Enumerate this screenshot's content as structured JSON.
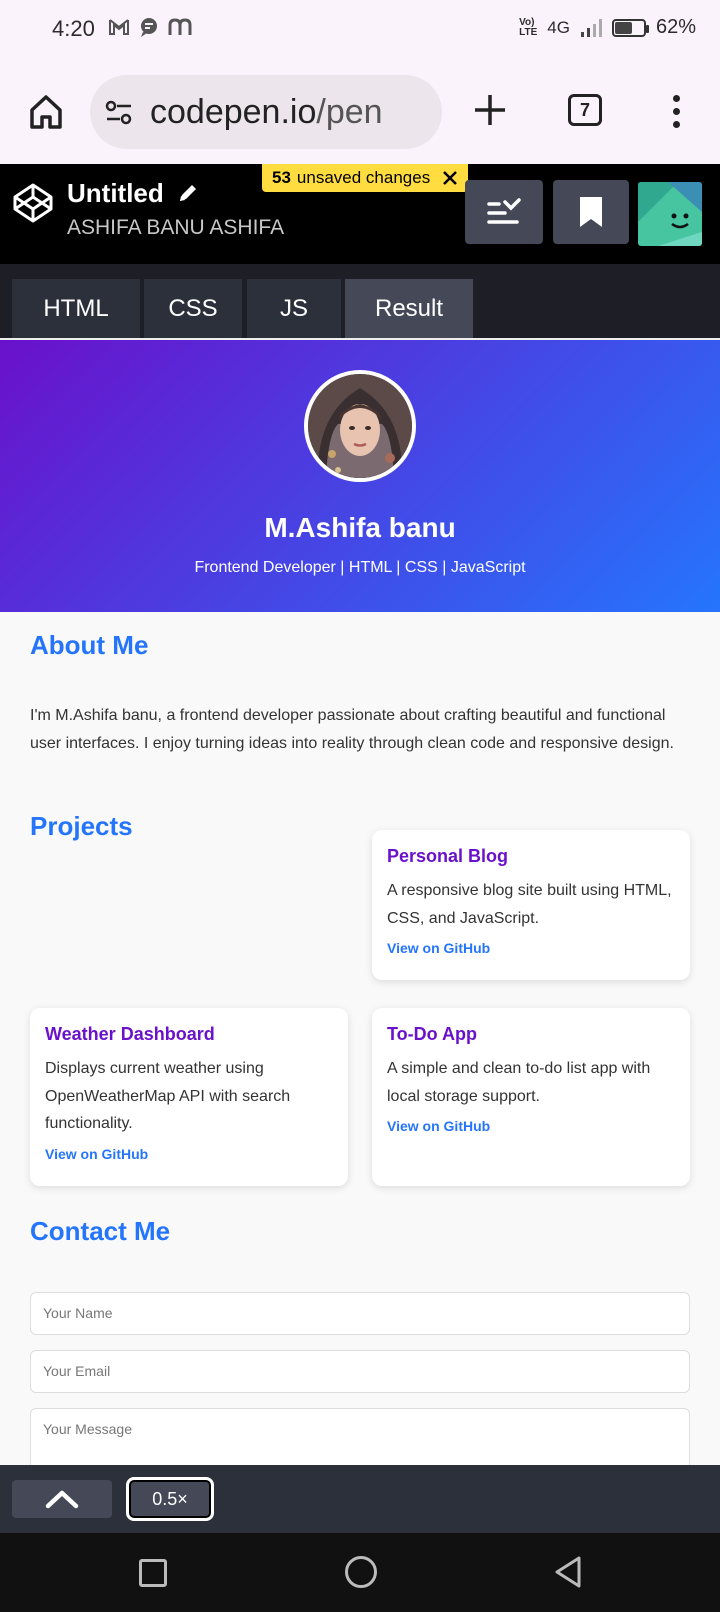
{
  "status_bar": {
    "time": "4:20",
    "network_badge": "Vo)\nLTE",
    "network": "4G",
    "battery_percent": "62%",
    "battery_level": 0.62
  },
  "browser": {
    "url_host": "codepen.io",
    "url_path": "/pen",
    "tab_count": "7"
  },
  "codepen": {
    "title": "Untitled",
    "author": "ASHIFA BANU ASHIFA",
    "unsaved_count": "53",
    "unsaved_label": "unsaved changes"
  },
  "tabs": [
    {
      "label": "HTML",
      "active": false
    },
    {
      "label": "CSS",
      "active": false
    },
    {
      "label": "JS",
      "active": false
    },
    {
      "label": "Result",
      "active": true
    }
  ],
  "result": {
    "hero": {
      "name": "M.Ashifa banu",
      "subtitle": "Frontend Developer | HTML | CSS | JavaScript"
    },
    "about": {
      "heading": "About Me",
      "text": "I'm M.Ashifa banu, a frontend developer passionate about crafting beautiful and functional user interfaces. I enjoy turning ideas into reality through clean code and responsive design."
    },
    "projects": {
      "heading": "Projects",
      "items": [
        {
          "title": "Personal Blog",
          "desc": "A responsive blog site built using HTML, CSS, and JavaScript.",
          "link": "View on GitHub"
        },
        {
          "title": "Weather Dashboard",
          "desc": "Displays current weather using OpenWeatherMap API with search functionality.",
          "link": "View on GitHub"
        },
        {
          "title": "To-Do App",
          "desc": "A simple and clean to-do list app with local storage support.",
          "link": "View on GitHub"
        }
      ]
    },
    "contact": {
      "heading": "Contact Me",
      "name_placeholder": "Your Name",
      "email_placeholder": "Your Email",
      "message_placeholder": "Your Message"
    }
  },
  "bottom": {
    "zoom": "0.5×"
  },
  "colors": {
    "gradient_start": "#6a11cb",
    "gradient_end": "#2575fc",
    "unsaved_badge": "#ffdd40",
    "codepen_dark": "#000000"
  }
}
